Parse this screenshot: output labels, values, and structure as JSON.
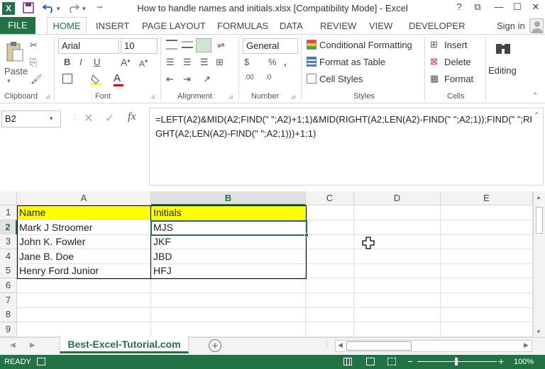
{
  "window": {
    "title": "How to handle names and initials.xlsx  [Compatibility Mode] - Excel",
    "help": "?",
    "restore": "⧉",
    "minimize": "—",
    "maximize": "☐",
    "close": "✕"
  },
  "ribbon_tabs": [
    "FILE",
    "HOME",
    "INSERT",
    "PAGE LAYOUT",
    "FORMULAS",
    "DATA",
    "REVIEW",
    "VIEW",
    "DEVELOPER"
  ],
  "account": {
    "sign_in": "Sign in"
  },
  "clipboard": {
    "paste": "Paste",
    "label": "Clipboard"
  },
  "font": {
    "name": "Arial",
    "size": "10",
    "label": "Font"
  },
  "alignment": {
    "label": "Alignment"
  },
  "number": {
    "format": "General",
    "label": "Number",
    "currency": "$",
    "percent": "%",
    "comma": ",",
    "inc_decimal": ".00",
    "dec_decimal": ".0"
  },
  "styles": {
    "conditional": "Conditional Formatting",
    "format_table": "Format as Table",
    "cell_styles": "Cell Styles",
    "label": "Styles"
  },
  "cells": {
    "insert": "Insert",
    "delete": "Delete",
    "format": "Format",
    "label": "Cells"
  },
  "editing": {
    "label": "Editing"
  },
  "formula_bar": {
    "name_box": "B2",
    "fx": "fx",
    "formula": "=LEFT(A2)&MID(A2;FIND(\" \";A2)+1;1)&MID(RIGHT(A2;LEN(A2)-FIND(\" \";A2;1));FIND(\" \";RIGHT(A2;LEN(A2)-FIND(\" \";A2;1)))+1;1)"
  },
  "columns": [
    "A",
    "B",
    "C",
    "D",
    "E"
  ],
  "rows": [
    "1",
    "2",
    "3",
    "4",
    "5",
    "6",
    "7",
    "8",
    "9"
  ],
  "table": {
    "headers": [
      "Name",
      "Initials"
    ],
    "data": [
      [
        "Mark J Stroomer",
        "MJS"
      ],
      [
        "John K. Fowler",
        "JKF"
      ],
      [
        "Jane B. Doe",
        "JBD"
      ],
      [
        "Henry Ford Junior",
        "HFJ"
      ]
    ],
    "header_fill": "#ffff00"
  },
  "sheet": {
    "tab": "Best-Excel-Tutorial.com",
    "add": "+"
  },
  "status": {
    "ready": "READY",
    "zoom": "100%",
    "zoom_minus": "−",
    "zoom_plus": "+"
  },
  "colors": {
    "accent": "#217346"
  }
}
